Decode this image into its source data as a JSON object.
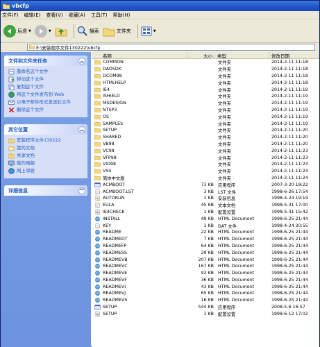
{
  "window": {
    "title": "vbcfp"
  },
  "menu": [
    "文件(F)",
    "编辑(E)",
    "查看(V)",
    "收藏(A)",
    "工具(T)",
    "帮助(H)"
  ],
  "toolbar": {
    "back": "后退",
    "search": "搜索",
    "folders": "文件夹"
  },
  "address": {
    "path": "E:\\安装程序文件130222\\vbcfp"
  },
  "tasks": {
    "title": "文件和文件夹任务",
    "items": [
      "重命名这个文件",
      "移动这个文件",
      "复制这个文件",
      "将这个文件发布到 Web",
      "以电子邮件形式发送此文件",
      "删除这个文件"
    ]
  },
  "places": {
    "title": "其它位置",
    "items": [
      "安装程序文件130222",
      "我的文档",
      "共享文档",
      "我的电脑",
      "网上邻居"
    ]
  },
  "details": {
    "title": "详细信息"
  },
  "columns": {
    "name": "名称",
    "size": "大小",
    "type": "类型",
    "date": "修改日期"
  },
  "files": [
    {
      "name": "COMMON",
      "size": "",
      "type": "文件夹",
      "date": "2014-2-11 11:18",
      "icon": "folder"
    },
    {
      "name": "DAOSDK",
      "size": "",
      "type": "文件夹",
      "date": "2014-2-11 11:18",
      "icon": "folder"
    },
    {
      "name": "DCOM98",
      "size": "",
      "type": "文件夹",
      "date": "2014-2-11 11:18",
      "icon": "folder"
    },
    {
      "name": "HTMLHELP",
      "size": "",
      "type": "文件夹",
      "date": "2014-2-11 11:18",
      "icon": "folder"
    },
    {
      "name": "IE4",
      "size": "",
      "type": "文件夹",
      "date": "2014-2-11 11:19",
      "icon": "folder"
    },
    {
      "name": "ISHIELD",
      "size": "",
      "type": "文件夹",
      "date": "2014-2-11 11:19",
      "icon": "folder"
    },
    {
      "name": "MSDESIGN",
      "size": "",
      "type": "文件夹",
      "date": "2014-2-11 11:19",
      "icon": "folder"
    },
    {
      "name": "NTSP3",
      "size": "",
      "type": "文件夹",
      "date": "2014-2-11 11:19",
      "icon": "folder"
    },
    {
      "name": "OS",
      "size": "",
      "type": "文件夹",
      "date": "2014-2-11 11:19",
      "icon": "folder"
    },
    {
      "name": "SAMPLES",
      "size": "",
      "type": "文件夹",
      "date": "2014-2-11 11:19",
      "icon": "folder"
    },
    {
      "name": "SETUP",
      "size": "",
      "type": "文件夹",
      "date": "2014-2-11 11:20",
      "icon": "folder"
    },
    {
      "name": "SHARED",
      "size": "",
      "type": "文件夹",
      "date": "2014-2-11 11:20",
      "icon": "folder"
    },
    {
      "name": "VB98",
      "size": "",
      "type": "文件夹",
      "date": "2014-2-11 11:20",
      "icon": "folder"
    },
    {
      "name": "VC98",
      "size": "",
      "type": "文件夹",
      "date": "2014-2-11 11:23",
      "icon": "folder"
    },
    {
      "name": "VFP98",
      "size": "",
      "type": "文件夹",
      "date": "2014-2-11 11:23",
      "icon": "folder"
    },
    {
      "name": "VID98",
      "size": "",
      "type": "文件夹",
      "date": "2014-2-11 11:24",
      "icon": "folder"
    },
    {
      "name": "VSS",
      "size": "",
      "type": "文件夹",
      "date": "2014-2-11 11:24",
      "icon": "folder"
    },
    {
      "name": "简体中文版",
      "size": "",
      "type": "文件夹",
      "date": "2014-2-11 11:24",
      "icon": "folder"
    },
    {
      "name": "ACMBOOT",
      "size": "73 KB",
      "type": "应用程序",
      "date": "2007-3-20 18:22",
      "icon": "app"
    },
    {
      "name": "ACMBOOT.LST",
      "size": "3 KB",
      "type": "LST 文件",
      "date": "1998-6-26 17:54",
      "icon": "doc"
    },
    {
      "name": "AUTORUN",
      "size": "1 KB",
      "type": "安装信息",
      "date": "1998-4-24 19:19",
      "icon": "inf"
    },
    {
      "name": "EULA",
      "size": "45 KB",
      "type": "文本文档",
      "date": "1998-5-31 17:00",
      "icon": "doc"
    },
    {
      "name": "IE4CHECK",
      "size": "1 KB",
      "type": "配置设置",
      "date": "1998-5-31 15:42",
      "icon": "ini"
    },
    {
      "name": "INSTALL",
      "size": "49 KB",
      "type": "HTML Document",
      "date": "1998-6-25 21:44",
      "icon": "html"
    },
    {
      "name": "KEY",
      "size": "1 KB",
      "type": "DAT 文件",
      "date": "1998-4-24 20:55",
      "icon": "doc"
    },
    {
      "name": "README",
      "size": "22 KB",
      "type": "HTML Document",
      "date": "1998-6-25 21:44",
      "icon": "html"
    },
    {
      "name": "READMEDT",
      "size": "7 KB",
      "type": "HTML Document",
      "date": "1998-6-25 21:44",
      "icon": "html"
    },
    {
      "name": "READMEFP",
      "size": "64 KB",
      "type": "HTML Document",
      "date": "1998-6-25 21:44",
      "icon": "html"
    },
    {
      "name": "READMESS",
      "size": "29 KB",
      "type": "HTML Document",
      "date": "1998-6-25 21:44",
      "icon": "html"
    },
    {
      "name": "READMEVB",
      "size": "207 KB",
      "type": "HTML Document",
      "date": "1998-6-25 21:44",
      "icon": "html"
    },
    {
      "name": "READMEVC",
      "size": "167 KB",
      "type": "HTML Document",
      "date": "1998-6-25 21:44",
      "icon": "html"
    },
    {
      "name": "READMEVE",
      "size": "92 KB",
      "type": "HTML Document",
      "date": "1998-6-25 21:44",
      "icon": "html"
    },
    {
      "name": "READMEVF",
      "size": "36 KB",
      "type": "HTML Document",
      "date": "1998-6-25 21:44",
      "icon": "html"
    },
    {
      "name": "READMEVI",
      "size": "43 KB",
      "type": "HTML Document",
      "date": "1998-6-25 21:44",
      "icon": "html"
    },
    {
      "name": "READMEVJ",
      "size": "65 KB",
      "type": "HTML Document",
      "date": "1998-6-25 21:44",
      "icon": "html"
    },
    {
      "name": "READMEVS",
      "size": "16 KB",
      "type": "HTML Document",
      "date": "1998-6-25 21:44",
      "icon": "html"
    },
    {
      "name": "SETUP",
      "size": "544 KB",
      "type": "应用程序",
      "date": "2008-5-6 16:57",
      "icon": "app"
    },
    {
      "name": "SETUP",
      "size": "1 KB",
      "type": "配置设置",
      "date": "1998-6-12 17:02",
      "icon": "ini"
    }
  ]
}
